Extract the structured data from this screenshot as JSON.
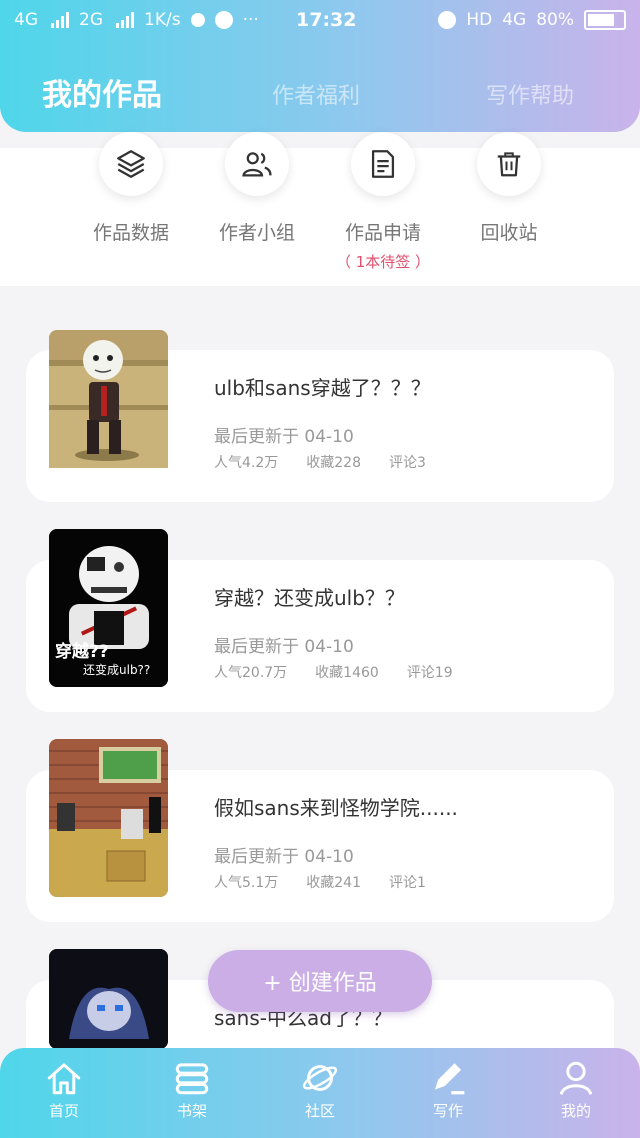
{
  "status": {
    "net1": "4G",
    "net2": "2G",
    "speed": "1K/s",
    "time": "17:32",
    "right_net": "HD",
    "right_net2": "4G",
    "battery": "80%",
    "dots": "···"
  },
  "tabs": {
    "active": "我的作品",
    "t2": "作者福利",
    "t3": "写作帮助"
  },
  "quick": [
    {
      "label": "作品数据",
      "icon": "layers-icon"
    },
    {
      "label": "作者小组",
      "icon": "group-icon"
    },
    {
      "label": "作品申请",
      "sub": "（ 1本待签 ）",
      "icon": "document-icon"
    },
    {
      "label": "回收站",
      "icon": "trash-icon"
    }
  ],
  "works": [
    {
      "title": "ulb和sans穿越了？？？",
      "updated": "最后更新于 04-10",
      "popularity": "人气4.2万",
      "favorites": "收藏228",
      "comments": "评论3"
    },
    {
      "title": "穿越？还变成ulb？？",
      "updated": "最后更新于 04-10",
      "popularity": "人气20.7万",
      "favorites": "收藏1460",
      "comments": "评论19",
      "cover_text_1": "穿越??",
      "cover_text_2": "还变成ulb??"
    },
    {
      "title": "假如sans来到怪物学院......",
      "updated": "最后更新于 04-10",
      "popularity": "人气5.1万",
      "favorites": "收藏241",
      "comments": "评论1"
    },
    {
      "title": "sans-中么ad了？？"
    }
  ],
  "fab": {
    "label": "+ 创建作品"
  },
  "nav": [
    {
      "label": "首页",
      "icon": "home-icon"
    },
    {
      "label": "书架",
      "icon": "bookshelf-icon"
    },
    {
      "label": "社区",
      "icon": "planet-icon"
    },
    {
      "label": "写作",
      "icon": "pen-icon"
    },
    {
      "label": "我的",
      "icon": "person-icon"
    }
  ]
}
